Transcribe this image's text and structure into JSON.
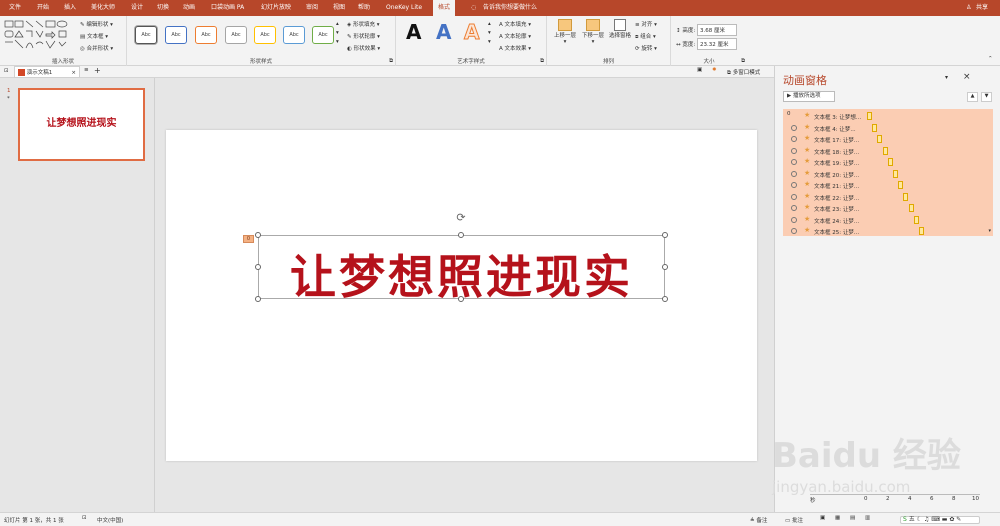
{
  "tabs": [
    "文件",
    "开始",
    "插入",
    "美化大师",
    "设计",
    "切换",
    "动画",
    "口袋动画 PA",
    "幻灯片放映",
    "审阅",
    "视图",
    "帮助",
    "OneKey Lite",
    "格式"
  ],
  "tell_me": "告诉我你想要做什么",
  "share": "共享",
  "ribbon": {
    "insert_shapes": {
      "label": "插入形状",
      "edit_shape": "编辑形状",
      "text_box": "文本框",
      "merge_shapes": "合并形状"
    },
    "shape_styles": {
      "label": "形状样式",
      "sample": "Abc",
      "fill": "形状填充",
      "outline": "形状轮廓",
      "effects": "形状效果"
    },
    "wordart": {
      "label": "艺术字样式",
      "letter": "A",
      "text_fill": "文本填充",
      "text_outline": "文本轮廓",
      "text_effects": "文本效果"
    },
    "arrange": {
      "label": "排列",
      "bring_forward": "上移一层",
      "send_backward": "下移一层",
      "selection_pane": "选择窗格",
      "align": "对齐",
      "group": "组合",
      "rotate": "旋转"
    },
    "size": {
      "label": "大小",
      "height_label": "高度:",
      "height_value": "3.68 厘米",
      "width_label": "宽度:",
      "width_value": "23.32 厘米"
    }
  },
  "document": {
    "tab_name": "演示文稿1",
    "multi_window": "多窗口模式"
  },
  "thumbnail": {
    "number": "1",
    "star": "*",
    "text": "让梦想照进现实"
  },
  "slide": {
    "title_text": "让梦想照进现实",
    "anim_tag": "0"
  },
  "anim_pane": {
    "title": "动画窗格",
    "play_all": "播放所选项",
    "first_index": "0",
    "items": [
      "文本框 3: 让梦想...",
      "文本框 4: 让梦...",
      "文本框 17: 让梦...",
      "文本框 18: 让梦...",
      "文本框 19: 让梦...",
      "文本框 20: 让梦...",
      "文本框 21: 让梦...",
      "文本框 22: 让梦...",
      "文本框 23: 让梦...",
      "文本框 24: 让梦...",
      "文本框 25: 让梦..."
    ],
    "timeline_prefix": "秒",
    "timeline_ticks": [
      "0",
      "2",
      "4",
      "6",
      "8",
      "10"
    ]
  },
  "status": {
    "slide_info": "幻灯片 第 1 张，共 1 张",
    "language": "中文(中国)",
    "notes": "备注",
    "comments": "批注"
  },
  "watermark": {
    "brand": "Baidu 经验",
    "url": "jingyan.baidu.com"
  },
  "colors": {
    "accent": "#b7472a",
    "slide_text": "#b5121b",
    "anim_bg": "#fbcdb3"
  }
}
